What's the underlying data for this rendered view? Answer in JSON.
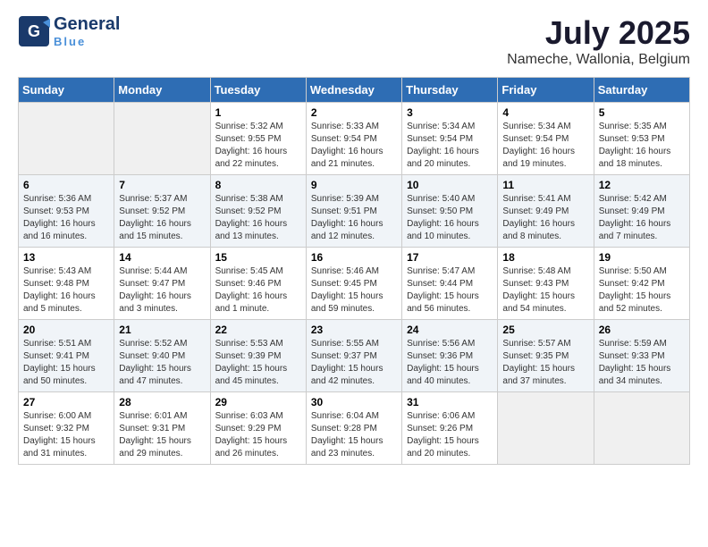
{
  "header": {
    "logo_general": "General",
    "logo_blue": "Blue",
    "title": "July 2025",
    "subtitle": "Nameche, Wallonia, Belgium"
  },
  "days_of_week": [
    "Sunday",
    "Monday",
    "Tuesday",
    "Wednesday",
    "Thursday",
    "Friday",
    "Saturday"
  ],
  "weeks": [
    [
      {
        "day": "",
        "sunrise": "",
        "sunset": "",
        "daylight": "",
        "empty": true
      },
      {
        "day": "",
        "sunrise": "",
        "sunset": "",
        "daylight": "",
        "empty": true
      },
      {
        "day": "1",
        "sunrise": "Sunrise: 5:32 AM",
        "sunset": "Sunset: 9:55 PM",
        "daylight": "Daylight: 16 hours and 22 minutes."
      },
      {
        "day": "2",
        "sunrise": "Sunrise: 5:33 AM",
        "sunset": "Sunset: 9:54 PM",
        "daylight": "Daylight: 16 hours and 21 minutes."
      },
      {
        "day": "3",
        "sunrise": "Sunrise: 5:34 AM",
        "sunset": "Sunset: 9:54 PM",
        "daylight": "Daylight: 16 hours and 20 minutes."
      },
      {
        "day": "4",
        "sunrise": "Sunrise: 5:34 AM",
        "sunset": "Sunset: 9:54 PM",
        "daylight": "Daylight: 16 hours and 19 minutes."
      },
      {
        "day": "5",
        "sunrise": "Sunrise: 5:35 AM",
        "sunset": "Sunset: 9:53 PM",
        "daylight": "Daylight: 16 hours and 18 minutes."
      }
    ],
    [
      {
        "day": "6",
        "sunrise": "Sunrise: 5:36 AM",
        "sunset": "Sunset: 9:53 PM",
        "daylight": "Daylight: 16 hours and 16 minutes."
      },
      {
        "day": "7",
        "sunrise": "Sunrise: 5:37 AM",
        "sunset": "Sunset: 9:52 PM",
        "daylight": "Daylight: 16 hours and 15 minutes."
      },
      {
        "day": "8",
        "sunrise": "Sunrise: 5:38 AM",
        "sunset": "Sunset: 9:52 PM",
        "daylight": "Daylight: 16 hours and 13 minutes."
      },
      {
        "day": "9",
        "sunrise": "Sunrise: 5:39 AM",
        "sunset": "Sunset: 9:51 PM",
        "daylight": "Daylight: 16 hours and 12 minutes."
      },
      {
        "day": "10",
        "sunrise": "Sunrise: 5:40 AM",
        "sunset": "Sunset: 9:50 PM",
        "daylight": "Daylight: 16 hours and 10 minutes."
      },
      {
        "day": "11",
        "sunrise": "Sunrise: 5:41 AM",
        "sunset": "Sunset: 9:49 PM",
        "daylight": "Daylight: 16 hours and 8 minutes."
      },
      {
        "day": "12",
        "sunrise": "Sunrise: 5:42 AM",
        "sunset": "Sunset: 9:49 PM",
        "daylight": "Daylight: 16 hours and 7 minutes."
      }
    ],
    [
      {
        "day": "13",
        "sunrise": "Sunrise: 5:43 AM",
        "sunset": "Sunset: 9:48 PM",
        "daylight": "Daylight: 16 hours and 5 minutes."
      },
      {
        "day": "14",
        "sunrise": "Sunrise: 5:44 AM",
        "sunset": "Sunset: 9:47 PM",
        "daylight": "Daylight: 16 hours and 3 minutes."
      },
      {
        "day": "15",
        "sunrise": "Sunrise: 5:45 AM",
        "sunset": "Sunset: 9:46 PM",
        "daylight": "Daylight: 16 hours and 1 minute."
      },
      {
        "day": "16",
        "sunrise": "Sunrise: 5:46 AM",
        "sunset": "Sunset: 9:45 PM",
        "daylight": "Daylight: 15 hours and 59 minutes."
      },
      {
        "day": "17",
        "sunrise": "Sunrise: 5:47 AM",
        "sunset": "Sunset: 9:44 PM",
        "daylight": "Daylight: 15 hours and 56 minutes."
      },
      {
        "day": "18",
        "sunrise": "Sunrise: 5:48 AM",
        "sunset": "Sunset: 9:43 PM",
        "daylight": "Daylight: 15 hours and 54 minutes."
      },
      {
        "day": "19",
        "sunrise": "Sunrise: 5:50 AM",
        "sunset": "Sunset: 9:42 PM",
        "daylight": "Daylight: 15 hours and 52 minutes."
      }
    ],
    [
      {
        "day": "20",
        "sunrise": "Sunrise: 5:51 AM",
        "sunset": "Sunset: 9:41 PM",
        "daylight": "Daylight: 15 hours and 50 minutes."
      },
      {
        "day": "21",
        "sunrise": "Sunrise: 5:52 AM",
        "sunset": "Sunset: 9:40 PM",
        "daylight": "Daylight: 15 hours and 47 minutes."
      },
      {
        "day": "22",
        "sunrise": "Sunrise: 5:53 AM",
        "sunset": "Sunset: 9:39 PM",
        "daylight": "Daylight: 15 hours and 45 minutes."
      },
      {
        "day": "23",
        "sunrise": "Sunrise: 5:55 AM",
        "sunset": "Sunset: 9:37 PM",
        "daylight": "Daylight: 15 hours and 42 minutes."
      },
      {
        "day": "24",
        "sunrise": "Sunrise: 5:56 AM",
        "sunset": "Sunset: 9:36 PM",
        "daylight": "Daylight: 15 hours and 40 minutes."
      },
      {
        "day": "25",
        "sunrise": "Sunrise: 5:57 AM",
        "sunset": "Sunset: 9:35 PM",
        "daylight": "Daylight: 15 hours and 37 minutes."
      },
      {
        "day": "26",
        "sunrise": "Sunrise: 5:59 AM",
        "sunset": "Sunset: 9:33 PM",
        "daylight": "Daylight: 15 hours and 34 minutes."
      }
    ],
    [
      {
        "day": "27",
        "sunrise": "Sunrise: 6:00 AM",
        "sunset": "Sunset: 9:32 PM",
        "daylight": "Daylight: 15 hours and 31 minutes."
      },
      {
        "day": "28",
        "sunrise": "Sunrise: 6:01 AM",
        "sunset": "Sunset: 9:31 PM",
        "daylight": "Daylight: 15 hours and 29 minutes."
      },
      {
        "day": "29",
        "sunrise": "Sunrise: 6:03 AM",
        "sunset": "Sunset: 9:29 PM",
        "daylight": "Daylight: 15 hours and 26 minutes."
      },
      {
        "day": "30",
        "sunrise": "Sunrise: 6:04 AM",
        "sunset": "Sunset: 9:28 PM",
        "daylight": "Daylight: 15 hours and 23 minutes."
      },
      {
        "day": "31",
        "sunrise": "Sunrise: 6:06 AM",
        "sunset": "Sunset: 9:26 PM",
        "daylight": "Daylight: 15 hours and 20 minutes."
      },
      {
        "day": "",
        "sunrise": "",
        "sunset": "",
        "daylight": "",
        "empty": true
      },
      {
        "day": "",
        "sunrise": "",
        "sunset": "",
        "daylight": "",
        "empty": true
      }
    ]
  ]
}
